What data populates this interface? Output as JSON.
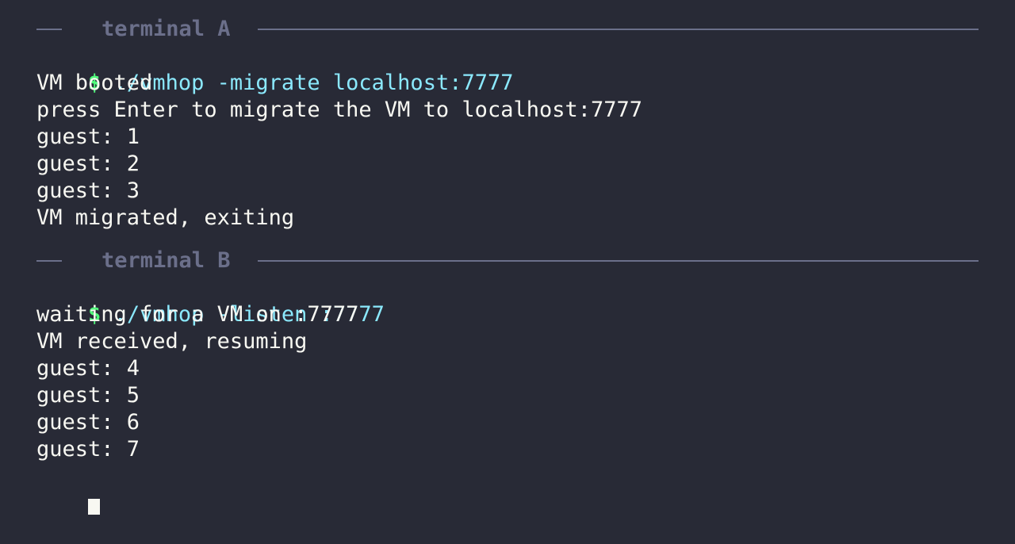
{
  "terminals": [
    {
      "title": "terminal A",
      "prompt": "$",
      "command": "./vmhop -migrate localhost:7777",
      "output": [
        "VM booted",
        "press Enter to migrate the VM to localhost:7777",
        "guest: 1",
        "guest: 2",
        "guest: 3",
        "VM migrated, exiting"
      ]
    },
    {
      "title": "terminal B",
      "prompt": "$",
      "command": "./vmhop -listen :7777",
      "output": [
        "waiting for a VM on :7777",
        "VM received, resuming",
        "guest: 4",
        "guest: 5",
        "guest: 6",
        "guest: 7"
      ],
      "cursor": true
    }
  ],
  "colors": {
    "background": "#282a36",
    "foreground": "#f8f8f2",
    "prompt": "#50fa7b",
    "command": "#8be9fd",
    "header": "#6b6f8a"
  }
}
